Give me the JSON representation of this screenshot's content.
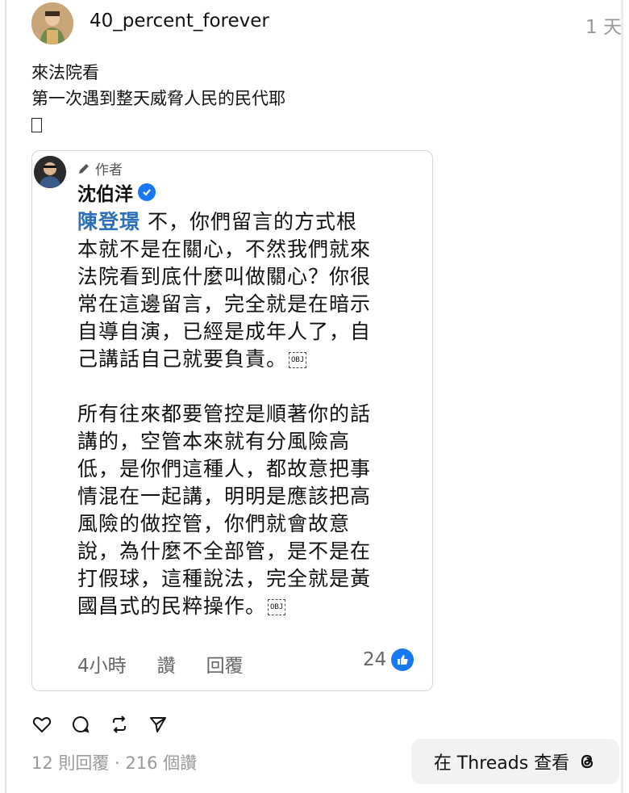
{
  "post": {
    "username": "40_percent_forever",
    "timestamp": "1 天",
    "lines": [
      "來法院看",
      "第一次遇到整天威脅人民的民代耶"
    ],
    "tofu_char": "□"
  },
  "embedded_comment": {
    "author_tag": "作者",
    "author_name": "沈伯洋",
    "mention": "陳登璟",
    "paragraph1_lines": [
      " 不，你們留言的方式根",
      "本就不是在關心，不然我們就來",
      "法院看到底什麼叫做關心？你很",
      "常在這邊留言，完全就是在暗示",
      "自導自演，已經是成年人了，自",
      "己講話自己就要負責。"
    ],
    "paragraph2_lines": [
      "所有往來都要管控是順著你的話",
      "講的，空管本來就有分風險高",
      "低，是你們這種人，都故意把事",
      "情混在一起講，明明是應該把高",
      "風險的做控管，你們就會故意",
      "說，為什麼不全部管，是不是在",
      "打假球，這種說法，完全就是黃",
      "國昌式的民粹操作。"
    ],
    "obj_label": "OBJ",
    "time": "4小時",
    "like_label": "讚",
    "reply_label": "回覆",
    "like_count": "24"
  },
  "actions": {
    "icons": [
      "heart-icon",
      "comment-icon",
      "repost-icon",
      "share-icon"
    ]
  },
  "stats": "12 則回覆 · 216 個讚",
  "open_button": {
    "label": "在 Threads 查看"
  },
  "colors": {
    "mention": "#2d6fb8",
    "facebook_blue": "#1877f2",
    "muted": "#999999"
  }
}
